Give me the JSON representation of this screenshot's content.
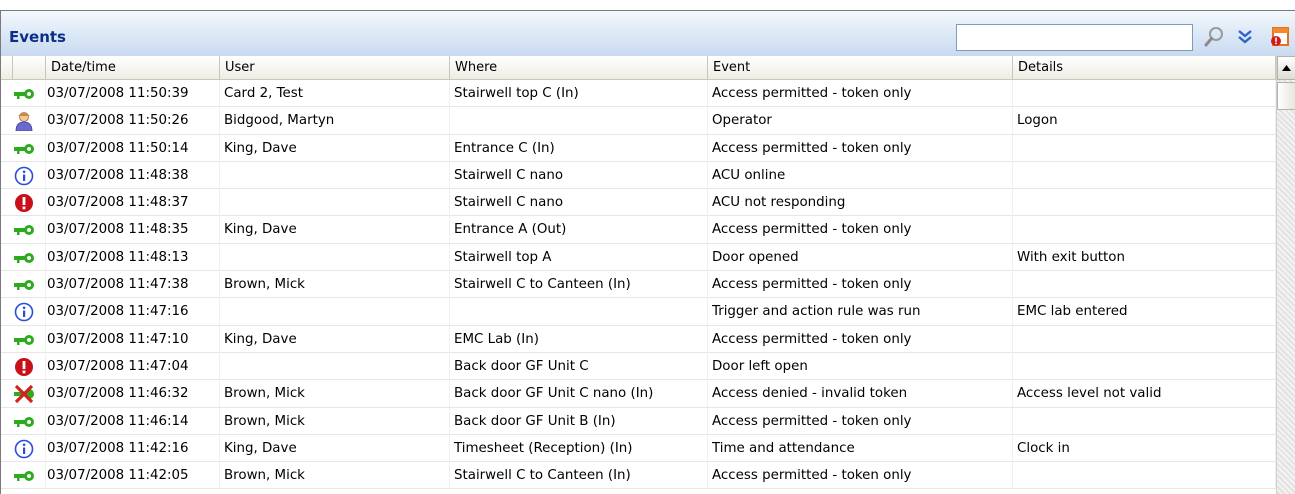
{
  "panel": {
    "title": "Events"
  },
  "search": {
    "value": "",
    "placeholder": ""
  },
  "toolbar": {
    "search_icon": "magnifier-icon",
    "expand_icon": "double-chevron-down-icon",
    "calendar_icon": "calendar-alert-icon"
  },
  "columns": [
    "Date/time",
    "User",
    "Where",
    "Event",
    "Details"
  ],
  "rows": [
    {
      "icon": "key",
      "date": "03/07/2008  11:50:39",
      "user": "Card 2, Test",
      "where": "Stairwell top C (In)",
      "event": "Access permitted - token only",
      "details": ""
    },
    {
      "icon": "operator",
      "date": "03/07/2008  11:50:26",
      "user": "Bidgood, Martyn",
      "where": "",
      "event": "Operator",
      "details": "Logon"
    },
    {
      "icon": "key",
      "date": "03/07/2008  11:50:14",
      "user": "King, Dave",
      "where": "Entrance C (In)",
      "event": "Access permitted - token only",
      "details": ""
    },
    {
      "icon": "info",
      "date": "03/07/2008  11:48:38",
      "user": "",
      "where": "Stairwell C nano",
      "event": "ACU online",
      "details": ""
    },
    {
      "icon": "alert",
      "date": "03/07/2008  11:48:37",
      "user": "",
      "where": "Stairwell C nano",
      "event": "ACU not responding",
      "details": ""
    },
    {
      "icon": "key",
      "date": "03/07/2008  11:48:35",
      "user": "King, Dave",
      "where": "Entrance A (Out)",
      "event": "Access permitted - token only",
      "details": ""
    },
    {
      "icon": "key",
      "date": "03/07/2008  11:48:13",
      "user": "",
      "where": "Stairwell top A",
      "event": "Door opened",
      "details": "With exit button"
    },
    {
      "icon": "key",
      "date": "03/07/2008  11:47:38",
      "user": "Brown, Mick",
      "where": "Stairwell C to Canteen (In)",
      "event": "Access permitted - token only",
      "details": ""
    },
    {
      "icon": "info",
      "date": "03/07/2008  11:47:16",
      "user": "",
      "where": "",
      "event": "Trigger and action rule was run",
      "details": " EMC lab entered"
    },
    {
      "icon": "key",
      "date": "03/07/2008  11:47:10",
      "user": "King, Dave",
      "where": "EMC Lab (In)",
      "event": "Access permitted - token only",
      "details": ""
    },
    {
      "icon": "alert",
      "date": "03/07/2008  11:47:04",
      "user": "",
      "where": "Back door GF Unit C",
      "event": "Door left open",
      "details": ""
    },
    {
      "icon": "denied",
      "date": "03/07/2008  11:46:32",
      "user": "Brown, Mick",
      "where": "Back door GF Unit C nano (In)",
      "event": "Access denied - invalid token",
      "details": "Access level not valid"
    },
    {
      "icon": "key",
      "date": "03/07/2008  11:46:14",
      "user": "Brown, Mick",
      "where": "Back door GF Unit B (In)",
      "event": "Access permitted - token only",
      "details": ""
    },
    {
      "icon": "info",
      "date": "03/07/2008  11:42:16",
      "user": "King, Dave",
      "where": "Timesheet (Reception) (In)",
      "event": "Time and attendance",
      "details": "Clock in"
    },
    {
      "icon": "key",
      "date": "03/07/2008  11:42:05",
      "user": "Brown, Mick",
      "where": "Stairwell C to Canteen (In)",
      "event": "Access permitted - token only",
      "details": ""
    }
  ],
  "colors": {
    "title_text": "#0b2e88",
    "key_icon": "#2eaa1e",
    "info_icon": "#2a4fd6",
    "alert_icon": "#c8101a",
    "denied_icon": "#d4201a"
  }
}
